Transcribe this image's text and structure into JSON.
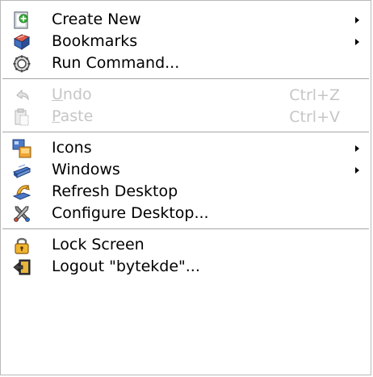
{
  "menu": {
    "group1": [
      {
        "label": "Create New",
        "icon": "create-new-icon",
        "submenu": true
      },
      {
        "label": "Bookmarks",
        "icon": "bookmarks-icon",
        "submenu": true
      },
      {
        "label": "Run Command...",
        "icon": "run-command-icon",
        "submenu": false
      }
    ],
    "group2": [
      {
        "label_first": "U",
        "label_rest": "ndo",
        "shortcut": "Ctrl+Z",
        "icon": "undo-icon",
        "disabled": true
      },
      {
        "label_first": "P",
        "label_rest": "aste",
        "shortcut": "Ctrl+V",
        "icon": "paste-icon",
        "disabled": true
      }
    ],
    "group3": [
      {
        "label": "Icons",
        "icon": "icons-icon",
        "submenu": true
      },
      {
        "label": "Windows",
        "icon": "windows-icon",
        "submenu": true
      },
      {
        "label": "Refresh Desktop",
        "icon": "refresh-desktop-icon",
        "submenu": false
      },
      {
        "label": "Configure Desktop...",
        "icon": "configure-desktop-icon",
        "submenu": false
      }
    ],
    "group4": [
      {
        "label": "Lock Screen",
        "icon": "lock-icon",
        "submenu": false
      },
      {
        "label": "Logout \"bytekde\"...",
        "icon": "logout-icon",
        "submenu": false
      }
    ]
  },
  "colors": {
    "disabled_text": "#c6c6c6",
    "separator": "#a6a6a6",
    "border": "#b9b9b9"
  }
}
